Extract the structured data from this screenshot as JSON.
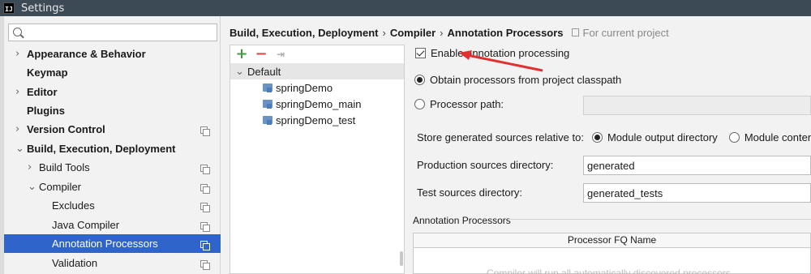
{
  "window": {
    "title": "Settings"
  },
  "search": {
    "placeholder": ""
  },
  "sidebar": {
    "items": [
      {
        "label": "Appearance & Behavior",
        "expander": "›",
        "bold": true
      },
      {
        "label": "Keymap",
        "bold": true
      },
      {
        "label": "Editor",
        "expander": "›",
        "bold": true
      },
      {
        "label": "Plugins",
        "bold": true
      },
      {
        "label": "Version Control",
        "expander": "›",
        "bold": true
      },
      {
        "label": "Build, Execution, Deployment",
        "expander": "⌄",
        "bold": true
      },
      {
        "label": "Build Tools",
        "expander": "›"
      },
      {
        "label": "Compiler",
        "expander": "⌄"
      },
      {
        "label": "Excludes"
      },
      {
        "label": "Java Compiler"
      },
      {
        "label": "Annotation Processors",
        "selected": true
      },
      {
        "label": "Validation"
      }
    ]
  },
  "breadcrumb": {
    "part1": "Build, Execution, Deployment",
    "part2": "Compiler",
    "part3": "Annotation Processors",
    "separator": "›",
    "scope": "For current project"
  },
  "modules": {
    "default_label": "Default",
    "items": [
      "springDemo",
      "springDemo_main",
      "springDemo_test"
    ]
  },
  "settings": {
    "enable_label": "Enable annotation processing",
    "enable_checked": true,
    "obtain_label": "Obtain processors from project classpath",
    "processor_path_label": "Processor path:",
    "processor_path_value": "",
    "store_label": "Store generated sources relative to:",
    "module_output_label": "Module output directory",
    "module_content_label": "Module content",
    "production_label": "Production sources directory:",
    "production_value": "generated",
    "test_label": "Test sources directory:",
    "test_value": "generated_tests",
    "section_title": "Annotation Processors",
    "table_header": "Processor FQ Name",
    "table_empty_text": "Compiler will run all automatically discovered processors"
  },
  "colors": {
    "selection": "#2f65ca",
    "annotation_arrow": "#e03030",
    "titlebar": "#3c4a56"
  }
}
